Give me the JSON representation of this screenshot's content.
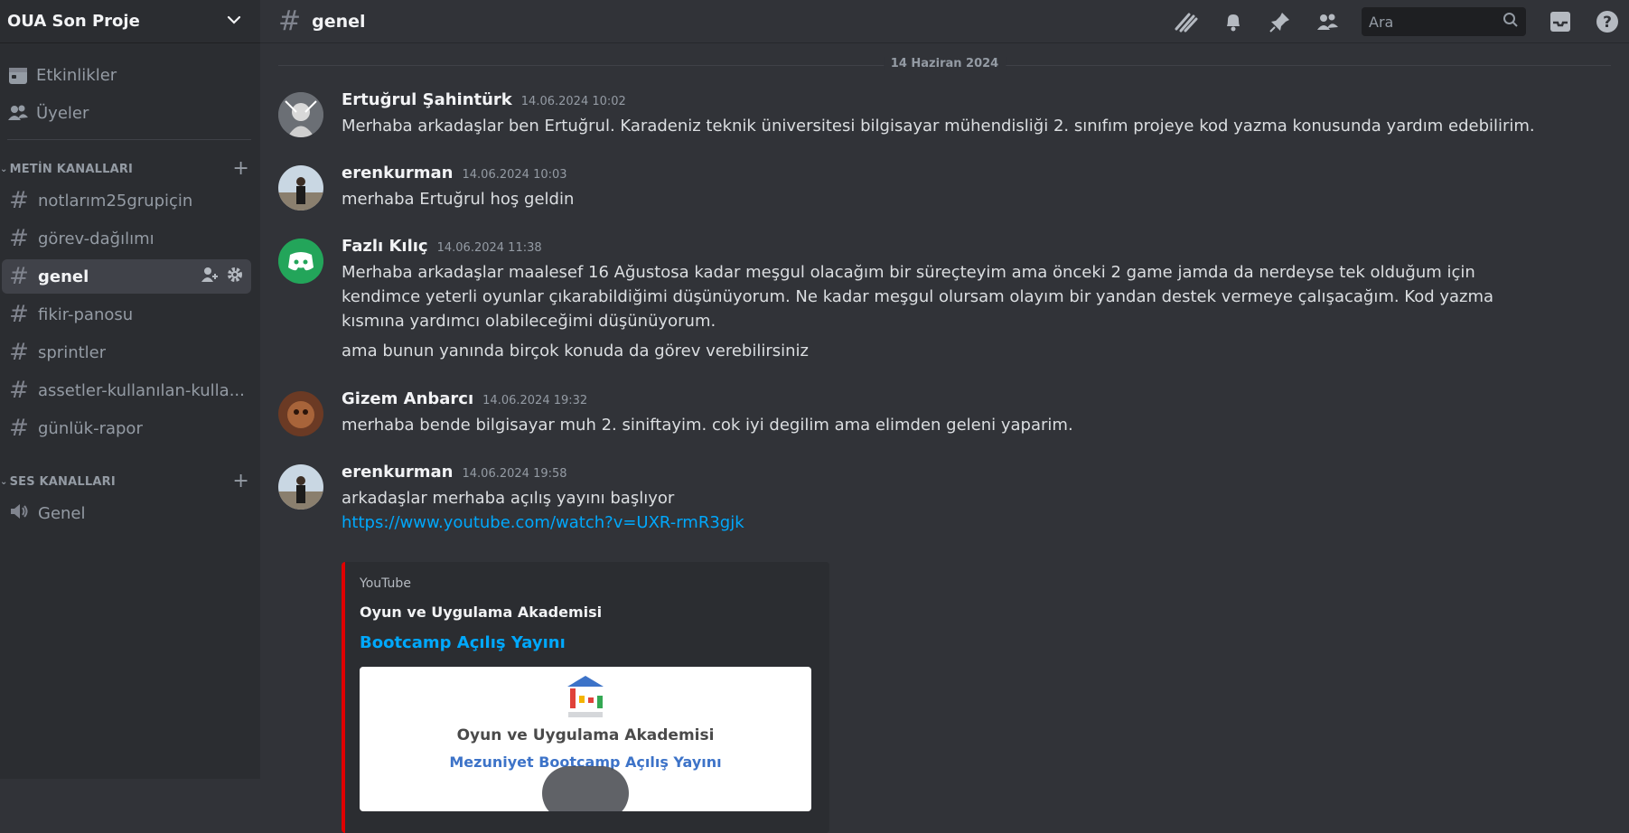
{
  "server": {
    "name": "OUA Son Proje"
  },
  "sidebar": {
    "top_items": [
      {
        "label": "Etkinlikler",
        "icon": "calendar-icon"
      },
      {
        "label": "Üyeler",
        "icon": "members-icon"
      }
    ],
    "text_category": "METİN KANALLARI",
    "voice_category": "SES KANALLARI",
    "text_channels": [
      {
        "label": "notlarım25grupiçin"
      },
      {
        "label": "görev-dağılımı"
      },
      {
        "label": "genel",
        "active": true
      },
      {
        "label": "fikir-panosu"
      },
      {
        "label": "sprintler"
      },
      {
        "label": "assetler-kullanılan-kulla..."
      },
      {
        "label": "günlük-rapor"
      }
    ],
    "voice_channels": [
      {
        "label": "Genel"
      }
    ]
  },
  "header": {
    "channel": "genel",
    "search_placeholder": "Ara"
  },
  "chat": {
    "date_divider": "14 Haziran 2024",
    "messages": [
      {
        "author": "Ertuğrul Şahintürk",
        "time": "14.06.2024 10:02",
        "text": "Merhaba arkadaşlar ben Ertuğrul. Karadeniz teknik üniversitesi bilgisayar mühendisliği 2. sınıfım projeye kod yazma konusunda yardım edebilirim."
      },
      {
        "author": "erenkurman",
        "time": "14.06.2024 10:03",
        "text": "merhaba Ertuğrul hoş geldin"
      },
      {
        "author": "Fazlı Kılıç",
        "time": "14.06.2024 11:38",
        "text": "Merhaba arkadaşlar maalesef 16 Ağustosa kadar meşgul olacağım bir süreçteyim ama önceki 2 game jamda da nerdeyse tek olduğum için kendimce yeterli oyunlar çıkarabildiğimi düşünüyorum. Ne kadar meşgul olursam olayım bir yandan destek vermeye çalışacağım. Kod yazma kısmına yardımcı olabileceğimi düşünüyorum.",
        "extra": "ama bunun yanında birçok konuda da görev verebilirsiniz"
      },
      {
        "author": "Gizem Anbarcı",
        "time": "14.06.2024 19:32",
        "text": "merhaba bende bilgisayar muh 2. siniftayim. cok iyi degilim ama elimden geleni yaparim."
      },
      {
        "author": "erenkurman",
        "time": "14.06.2024 19:58",
        "text": "arkadaşlar merhaba açılış yayını başlıyor",
        "link": "https://www.youtube.com/watch?v=UXR-rmR3gjk"
      }
    ],
    "embed": {
      "provider": "YouTube",
      "author": "Oyun ve Uygulama Akademisi",
      "title": "Bootcamp Açılış Yayını",
      "thumb_line1": "Oyun ve Uygulama Akademisi",
      "thumb_line2": "Mezuniyet Bootcamp Açılış Yayını",
      "accent": "#e00000"
    }
  },
  "colors": {
    "link": "#00a8fc",
    "background": "#313338",
    "sidebar": "#2b2d31"
  }
}
